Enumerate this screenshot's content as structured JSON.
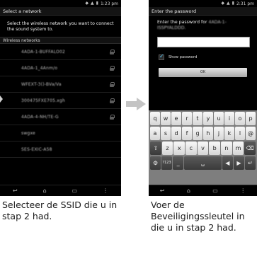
{
  "left_screen": {
    "status_time": "1:23 pm",
    "title": "Select a network",
    "instruction": "Select the wireless network you want to connect the sound system to.",
    "section_header": "Wireless networks",
    "networks": [
      {
        "name": "4ADA-1-BUFFALO02"
      },
      {
        "name": "4ADA-1_4Anm/o"
      },
      {
        "name": "WFEXT-3()-BVa/Va"
      },
      {
        "name": "300475FXE705.xgh"
      },
      {
        "name": "4ADA-4-NH/TE-G"
      },
      {
        "name": "swgxe"
      },
      {
        "name": "SES-EXIC-A58"
      }
    ]
  },
  "right_screen": {
    "status_time": "2:31 pm",
    "title": "Enter the password",
    "password_prompt": "Enter the password for",
    "password_ssid": "4ADA-1-ISSPYALDDD.",
    "show_password_label": "Show password",
    "ok_label": "OK",
    "keyboard": {
      "row1": [
        "q",
        "w",
        "e",
        "r",
        "t",
        "y",
        "u",
        "i",
        "o",
        "p"
      ],
      "row2": [
        "a",
        "s",
        "d",
        "f",
        "g",
        "h",
        "j",
        "k",
        "l",
        "@"
      ],
      "row3": [
        "⇧",
        "z",
        "x",
        "c",
        "v",
        "b",
        "n",
        "m",
        "⌫"
      ],
      "row4": [
        "⚙",
        "?123",
        "_",
        "␣",
        "◀",
        "▶",
        "↵"
      ]
    }
  },
  "captions": {
    "left": "Selecteer de SSID die u in stap 2 had.",
    "right": "Voer de Beveiligingssleutel in die u in stap 2 had."
  },
  "icons": {
    "nav_back": "back-icon",
    "nav_home": "home-icon",
    "nav_recent": "recent-apps-icon",
    "nav_menu": "menu-icon",
    "arrow": "right-arrow-icon"
  },
  "colors": {
    "screen_bg": "#000000",
    "arrow": "#c4c4c4",
    "checkbox_accent": "#5cd0ff"
  }
}
